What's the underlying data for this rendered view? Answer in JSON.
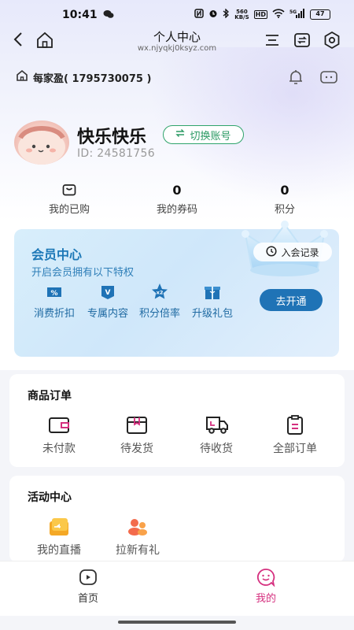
{
  "status_bar": {
    "time": "10:41",
    "net_speed_top": "560",
    "net_speed_bottom": "KB/S",
    "hd": "HD",
    "signal_label": "5G",
    "battery": "47"
  },
  "nav": {
    "title": "个人中心",
    "url": "wx.njyqkj0ksyz.com"
  },
  "store": {
    "name": "每家盈( 1795730075 )"
  },
  "profile": {
    "username": "快乐快乐",
    "switch_label": "切换账号",
    "user_id": "ID: 24581756"
  },
  "stats": [
    {
      "value": "",
      "label": "我的已购",
      "icon": "bag-icon"
    },
    {
      "value": "0",
      "label": "我的券码"
    },
    {
      "value": "0",
      "label": "积分"
    }
  ],
  "member": {
    "title": "会员中心",
    "subtitle": "开启会员拥有以下特权",
    "record_label": "入会记录",
    "join_label": "去开通",
    "perks": [
      {
        "label": "消费折扣",
        "icon_text": "%"
      },
      {
        "label": "专属内容",
        "icon_text": "V"
      },
      {
        "label": "积分倍率",
        "icon_text": "x2"
      },
      {
        "label": "升级礼包",
        "icon_text": ""
      }
    ],
    "colors": {
      "accent": "#1f73b6",
      "text": "#1d78b7"
    }
  },
  "orders": {
    "title": "商品订单",
    "items": [
      {
        "label": "未付款",
        "icon": "wallet-icon"
      },
      {
        "label": "待发货",
        "icon": "package-icon"
      },
      {
        "label": "待收货",
        "icon": "truck-icon"
      },
      {
        "label": "全部订单",
        "icon": "clipboard-icon"
      }
    ]
  },
  "activity": {
    "title": "活动中心",
    "items": [
      {
        "label": "我的直播",
        "icon": "live-icon"
      },
      {
        "label": "拉新有礼",
        "icon": "invite-icon"
      }
    ]
  },
  "tabbar": {
    "tabs": [
      {
        "label": "首页",
        "active": false
      },
      {
        "label": "我的",
        "active": true
      }
    ],
    "active_color": "#d5307f"
  }
}
